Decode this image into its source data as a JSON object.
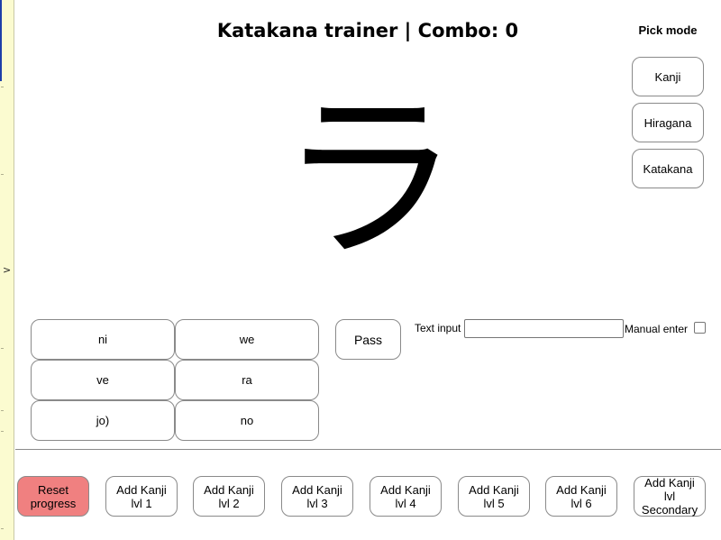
{
  "sidebar": {
    "toggle_glyph": ">"
  },
  "header": {
    "title": "Katakana trainer | Combo: 0"
  },
  "mode_picker": {
    "label": "Pick mode",
    "options": [
      "Kanji",
      "Hiragana",
      "Katakana"
    ]
  },
  "quiz": {
    "character": "ラ",
    "answers": [
      "ni",
      "we",
      "ve",
      "ra",
      "jo)",
      "no"
    ],
    "pass_label": "Pass"
  },
  "text_entry": {
    "label": "Text input",
    "value": "",
    "manual_enter_label": "Manual enter",
    "manual_enter_checked": false
  },
  "footer": {
    "reset_label": "Reset progress",
    "reset_color": "#f08080",
    "level_buttons": [
      "Add Kanji lvl 1",
      "Add Kanji lvl 2",
      "Add Kanji lvl 3",
      "Add Kanji lvl 4",
      "Add Kanji lvl 5",
      "Add Kanji lvl 6",
      "Add Kanji lvl Secondary"
    ]
  }
}
